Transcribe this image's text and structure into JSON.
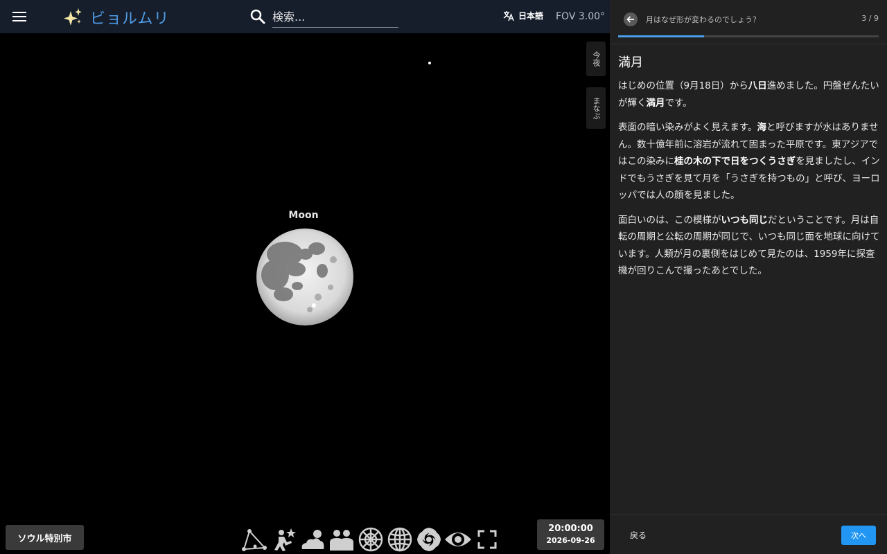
{
  "header": {
    "app_name": "ビョルムリ",
    "search_placeholder": "検索...",
    "language": "日本語",
    "fov": "FOV 3.00°"
  },
  "side_tabs": {
    "tonight": "今夜",
    "learn": "まなぶ"
  },
  "sky": {
    "moon_label": "Moon"
  },
  "bottom": {
    "location": "ソウル特別市",
    "time": "20:00:00",
    "date": "2026-09-26",
    "tools": [
      "constellation-lines-icon",
      "constellation-art-icon",
      "atmosphere-icon",
      "landscape-icon",
      "azimuthal-grid-icon",
      "equatorial-grid-icon",
      "deep-sky-icon",
      "night-mode-icon",
      "fullscreen-icon"
    ]
  },
  "panel": {
    "title": "月はなぜ形が変わるのでしょう？",
    "counter": "3 / 9",
    "progress": 0.33,
    "heading": "満月",
    "p1": [
      {
        "t": "はじめの位置（9月18日）から",
        "b": false
      },
      {
        "t": "八日",
        "b": true
      },
      {
        "t": "進めました。円盤ぜんたいが輝く",
        "b": false
      },
      {
        "t": "満月",
        "b": true
      },
      {
        "t": "です。",
        "b": false
      }
    ],
    "p2": [
      {
        "t": "表面の暗い染みがよく見えます。",
        "b": false
      },
      {
        "t": "海",
        "b": true
      },
      {
        "t": "と呼びますが水はありません。数十億年前に溶岩が流れて固まった平原です。東アジアではこの染みに",
        "b": false
      },
      {
        "t": "桂の木の下で日をつくうさぎ",
        "b": true
      },
      {
        "t": "を見ましたし、インドでもうさぎを見て月を「うさぎを持つもの」と呼び、ヨーロッパでは人の顔を見ました。",
        "b": false
      }
    ],
    "p3": [
      {
        "t": "面白いのは、この模様が",
        "b": false
      },
      {
        "t": "いつも同じ",
        "b": true
      },
      {
        "t": "だということです。月は自転の周期と公転の周期が同じで、いつも同じ面を地球に向けています。人類が月の裏側をはじめて見たのは、1959年に探査機が回りこんで撮ったあとでした。",
        "b": false
      }
    ],
    "back_label": "戻る",
    "next_label": "次へ"
  },
  "colors": {
    "accent": "#2196f3",
    "brand": "#4f9ce6",
    "panel_bg": "#212121"
  }
}
